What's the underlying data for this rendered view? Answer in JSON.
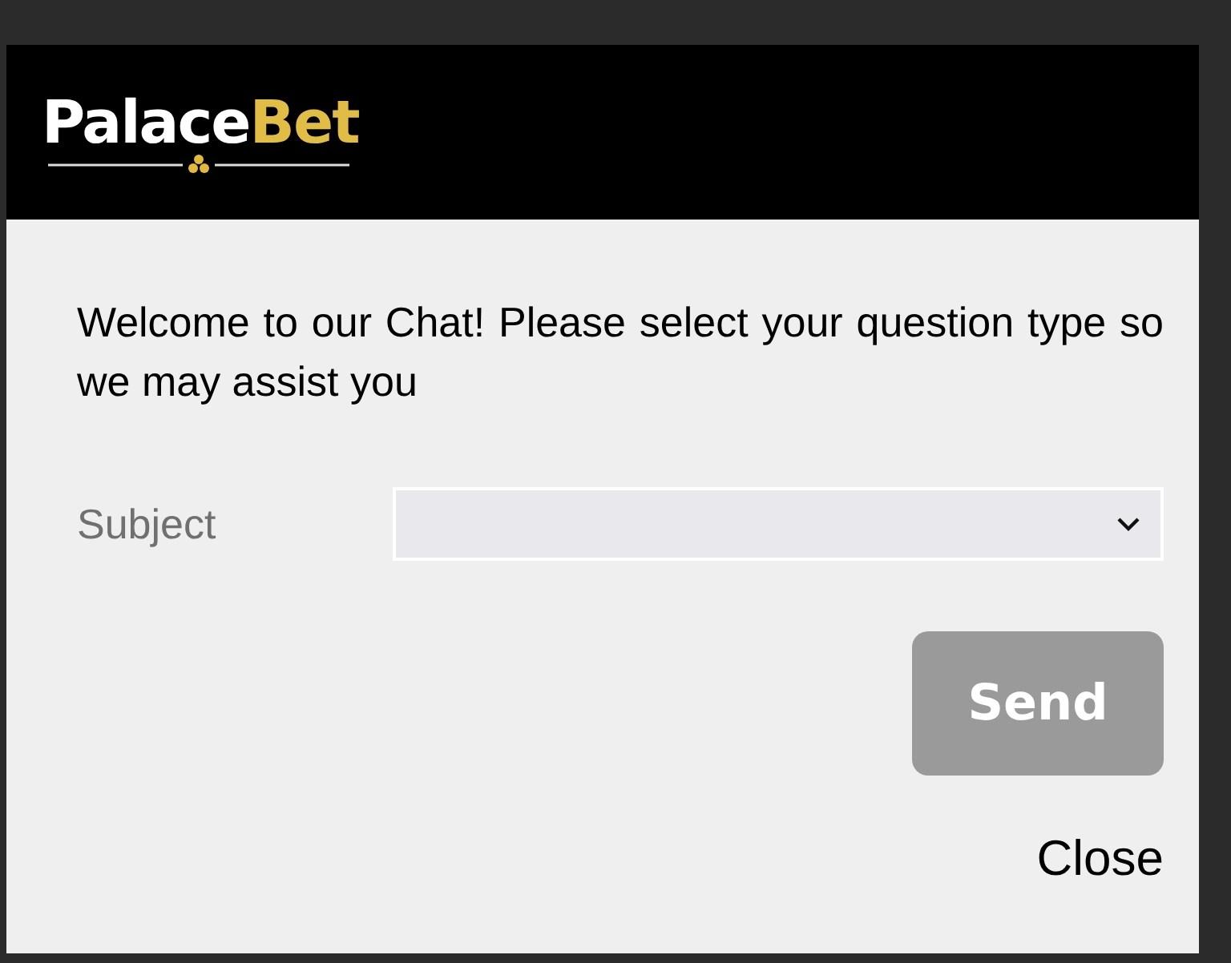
{
  "logo": {
    "primary": "Palace",
    "accent": "Bet"
  },
  "intro": "Welcome to our Chat! Please select your question type so we may assist you",
  "subject": {
    "label": "Subject"
  },
  "send_button": {
    "label": "Send",
    "disabled": true
  },
  "close_link": "Close"
}
